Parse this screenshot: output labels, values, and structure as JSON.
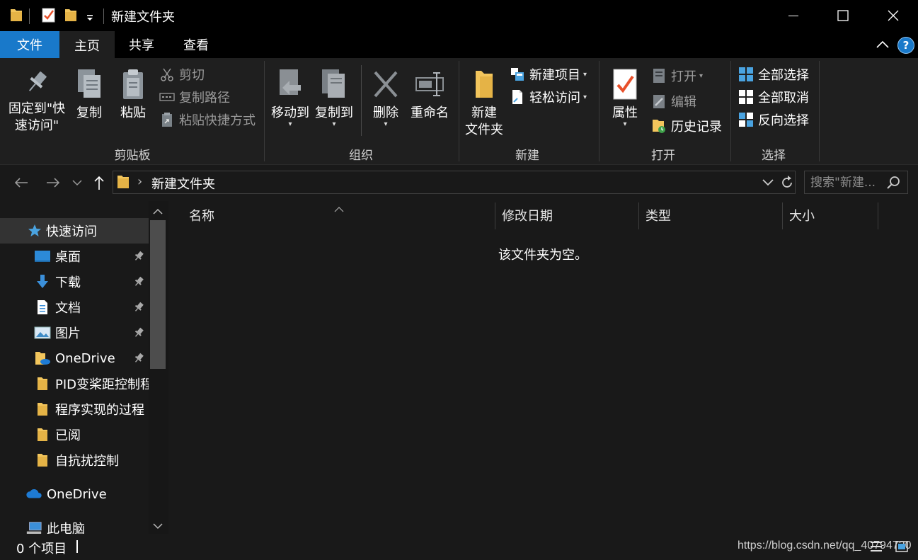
{
  "window": {
    "title": "新建文件夹",
    "controls": {
      "minimize": "minimize",
      "maximize": "maximize",
      "close": "close"
    }
  },
  "ribbon": {
    "tabs": [
      {
        "label": "文件",
        "active": false,
        "accent": "#1979ca"
      },
      {
        "label": "主页",
        "active": true
      },
      {
        "label": "共享",
        "active": false
      },
      {
        "label": "查看",
        "active": false
      }
    ],
    "help_label": "?",
    "groups": {
      "clipboard": {
        "label": "剪贴板",
        "pin_quick_access": "固定到\"快速访问\"",
        "copy": "复制",
        "paste": "粘贴",
        "cut": "剪切",
        "copy_path": "复制路径",
        "paste_shortcut": "粘贴快捷方式"
      },
      "organize": {
        "label": "组织",
        "move_to": "移动到",
        "copy_to": "复制到",
        "delete": "删除",
        "rename": "重命名"
      },
      "new": {
        "label": "新建",
        "new_folder_line1": "新建",
        "new_folder_line2": "文件夹",
        "new_item": "新建项目",
        "easy_access": "轻松访问"
      },
      "open": {
        "label": "打开",
        "properties": "属性",
        "open": "打开",
        "edit": "编辑",
        "history": "历史记录"
      },
      "select": {
        "label": "选择",
        "select_all": "全部选择",
        "select_none": "全部取消",
        "invert": "反向选择"
      }
    }
  },
  "address": {
    "path": [
      "新建文件夹"
    ],
    "separator": "›",
    "search_placeholder": "搜索\"新建..."
  },
  "nav_pane": {
    "quick_access": "快速访问",
    "items": [
      {
        "label": "桌面",
        "icon": "desktop-icon",
        "pinned": true
      },
      {
        "label": "下载",
        "icon": "download-icon",
        "pinned": true
      },
      {
        "label": "文档",
        "icon": "document-icon",
        "pinned": true
      },
      {
        "label": "图片",
        "icon": "pictures-icon",
        "pinned": true
      },
      {
        "label": "OneDrive",
        "icon": "onedrive-folder-icon",
        "pinned": true
      },
      {
        "label": "PID变桨距控制程",
        "icon": "folder-icon",
        "pinned": false
      },
      {
        "label": "程序实现的过程",
        "icon": "folder-icon",
        "pinned": false
      },
      {
        "label": "已阅",
        "icon": "folder-icon",
        "pinned": false
      },
      {
        "label": "自抗扰控制",
        "icon": "folder-icon",
        "pinned": false
      }
    ],
    "onedrive": "OneDrive",
    "this_pc": "此电脑"
  },
  "content": {
    "columns": [
      "名称",
      "修改日期",
      "类型",
      "大小"
    ],
    "empty_message": "该文件夹为空。"
  },
  "status": {
    "item_count": "0 个项目",
    "watermark": "https://blog.csdn.net/qq_40794730"
  },
  "colors": {
    "accent": "#1979ca",
    "folder": "#f2c55c",
    "background": "#191919"
  }
}
